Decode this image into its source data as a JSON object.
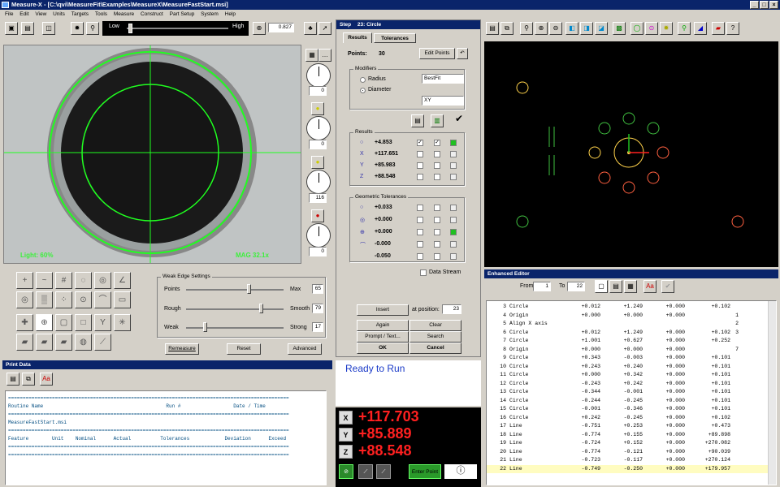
{
  "window": {
    "title": "Measure-X - [C:\\qvi\\MeasureFit\\Examples\\MeasureX\\MeasureFastStart.msi]"
  },
  "menu": [
    "File",
    "Edit",
    "View",
    "Units",
    "Targets",
    "Tools",
    "Measure",
    "Construct",
    "Part Setup",
    "System",
    "Help"
  ],
  "toolbar": {
    "slider_low": "Low",
    "slider_high": "High",
    "zoom_value": "0.827"
  },
  "camera": {
    "light_label": "Light: 60%",
    "mag_label": "MAG 32.1x"
  },
  "light_controls": {
    "values": [
      "0",
      "0",
      "116",
      "0"
    ]
  },
  "step": {
    "title": "Step",
    "number": "23: Circle",
    "tabs": [
      "Results",
      "Tolerances"
    ],
    "points_label": "Points:",
    "points_value": "30",
    "edit_points": "Edit Points",
    "modifiers": {
      "label": "Modifiers",
      "radius": "Radius",
      "diameter": "Diameter",
      "fit_method": "BestFit",
      "plane": "XY"
    },
    "results": {
      "label": "Results",
      "rows": [
        {
          "icon": "○",
          "value": "+4.853"
        },
        {
          "icon": "X",
          "value": "+117.651"
        },
        {
          "icon": "Y",
          "value": "+85.983"
        },
        {
          "icon": "Z",
          "value": "+88.548"
        }
      ]
    },
    "geo_tol": {
      "label": "Geometric Tolerances",
      "rows": [
        {
          "icon": "○",
          "value": "+0.033"
        },
        {
          "icon": "◎",
          "value": "+0.000"
        },
        {
          "icon": "⊕",
          "value": "+0.000"
        },
        {
          "icon": "⌒",
          "value": "-0.000"
        },
        {
          "icon": "",
          "value": "-0.050"
        }
      ]
    },
    "data_stream": "Data Stream"
  },
  "step_buttons": {
    "insert": "Insert",
    "at_position": "at position:",
    "position_value": "23",
    "again": "Again",
    "clear": "Clear",
    "prompt": "Prompt / Text...",
    "search": "Search",
    "ok": "OK",
    "cancel": "Cancel"
  },
  "status": {
    "ready": "Ready to Run"
  },
  "dro": {
    "x": "+117.703",
    "y": "+85.889",
    "z": "+88.548",
    "enter_point": "Enter Point"
  },
  "weak_edge": {
    "title": "Weak Edge Settings",
    "points_label": "Points",
    "points_max": "Max",
    "points_value": "65",
    "rough_label": "Rough",
    "rough_max": "Smooth",
    "rough_value": "79",
    "weak_label": "Weak",
    "weak_max": "Strong",
    "weak_value": "17",
    "remeasure": "Remeasure",
    "reset": "Reset",
    "advanced": "Advanced"
  },
  "print_data": {
    "title": "Print Data",
    "lines": [
      "================================================================================================",
      "Routine Name                                          Run #                  Date / Time",
      "================================================================================================",
      "MeasureFastStart.msi",
      "================================================================================================",
      "",
      "Feature        Unit    Nominal      Actual          Tolerances            Deviation      Exceed",
      "================================================================================================",
      "",
      "================================================================================================"
    ]
  },
  "editor": {
    "title": "Enhanced Editor",
    "from_label": "From",
    "from_value": "1",
    "to_label": "To",
    "to_value": "22",
    "rows": [
      [
        "3",
        "Circle",
        "+0.012",
        "+1.249",
        "+0.000",
        "+0.102",
        ""
      ],
      [
        "4",
        "Origin",
        "+0.000",
        "+0.000",
        "+0.000",
        "",
        "1"
      ],
      [
        "5",
        "Align X axis",
        "",
        "",
        "",
        "",
        "2"
      ],
      [
        "6",
        "Circle",
        "+0.012",
        "+1.249",
        "+0.000",
        "+0.102",
        "3"
      ],
      [
        "7",
        "Circle",
        "+1.001",
        "+0.627",
        "+0.000",
        "+0.252",
        ""
      ],
      [
        "8",
        "Origin",
        "+0.000",
        "+0.000",
        "+0.000",
        "",
        "7"
      ],
      [
        "9",
        "Circle",
        "+0.343",
        "-0.003",
        "+0.000",
        "+0.101",
        ""
      ],
      [
        "10",
        "Circle",
        "+0.243",
        "+0.240",
        "+0.000",
        "+0.101",
        ""
      ],
      [
        "11",
        "Circle",
        "+0.000",
        "+0.342",
        "+0.000",
        "+0.101",
        ""
      ],
      [
        "12",
        "Circle",
        "-0.243",
        "+0.242",
        "+0.000",
        "+0.101",
        ""
      ],
      [
        "13",
        "Circle",
        "-0.344",
        "-0.001",
        "+0.000",
        "+0.101",
        ""
      ],
      [
        "14",
        "Circle",
        "-0.244",
        "-0.245",
        "+0.000",
        "+0.101",
        ""
      ],
      [
        "15",
        "Circle",
        "-0.001",
        "-0.346",
        "+0.000",
        "+0.101",
        ""
      ],
      [
        "16",
        "Circle",
        "+0.242",
        "-0.245",
        "+0.000",
        "+0.102",
        ""
      ],
      [
        "17",
        "Line",
        "-0.751",
        "+0.253",
        "+0.000",
        "+0.473",
        ""
      ],
      [
        "18",
        "Line",
        "-0.774",
        "+0.155",
        "+0.000",
        "+89.898",
        ""
      ],
      [
        "19",
        "Line",
        "-0.724",
        "+0.152",
        "+0.000",
        "+270.082",
        ""
      ],
      [
        "20",
        "Line",
        "-0.774",
        "-0.121",
        "+0.000",
        "+90.039",
        ""
      ],
      [
        "21",
        "Line",
        "-0.723",
        "-0.117",
        "+0.000",
        "+270.124",
        ""
      ],
      [
        "22",
        "Line",
        "-0.749",
        "-0.250",
        "+0.000",
        "+179.957",
        ""
      ]
    ]
  }
}
